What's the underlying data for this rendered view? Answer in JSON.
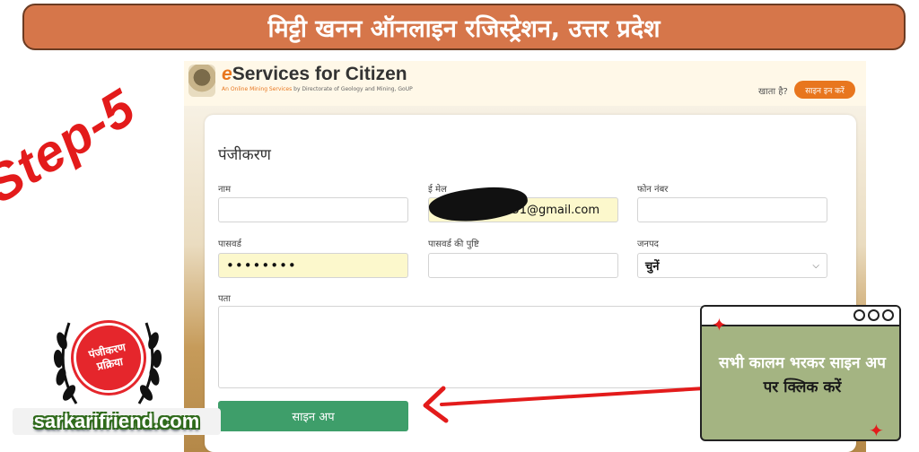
{
  "banner": {
    "title": "मिट्टी खनन ऑनलाइन रजिस्ट्रेशन, उत्तर प्रदेश"
  },
  "site_header": {
    "brand_e": "e",
    "brand_rest": "Services for Citizen",
    "subtitle_highlight": "An Online Mining Services",
    "subtitle_rest": "by Directorate of Geology and Mining, GoUP",
    "account_text": "खाता है?",
    "login_button": "साइन इन करें"
  },
  "form": {
    "heading": "पंजीकरण",
    "name_label": "नाम",
    "name_value": "",
    "email_label": "ई मेल",
    "email_value": "51@gmail.com",
    "phone_label": "फोन नंबर",
    "phone_value": "",
    "password_label": "पासवर्ड",
    "password_value": "••••••••",
    "confirm_label": "पासवर्ड की पुष्टि",
    "confirm_value": "",
    "district_label": "जनपद",
    "district_value": "चुनें",
    "address_label": "पता",
    "address_value": "",
    "signup_button": "साइन अप"
  },
  "overlay": {
    "step_label": "Step-5",
    "badge_line1": "पंजीकरण",
    "badge_line2": "प्रक्रिया",
    "site_name": "sarkarifriend.com",
    "note_part1": "सभी कालम भरकर साइन अप",
    "note_part2": "पर क्लिक करें"
  },
  "colors": {
    "banner": "#d6764a",
    "brand_orange": "#e8761e",
    "signup_green": "#3e9e6a",
    "annotation_red": "#e31b1b",
    "note_box": "#a4b482"
  },
  "icons": {
    "emblem": "state-emblem-icon",
    "select_caret": "chevron-down-icon",
    "sparkle": "sparkle-icon",
    "arrow": "arrow-left-icon"
  }
}
